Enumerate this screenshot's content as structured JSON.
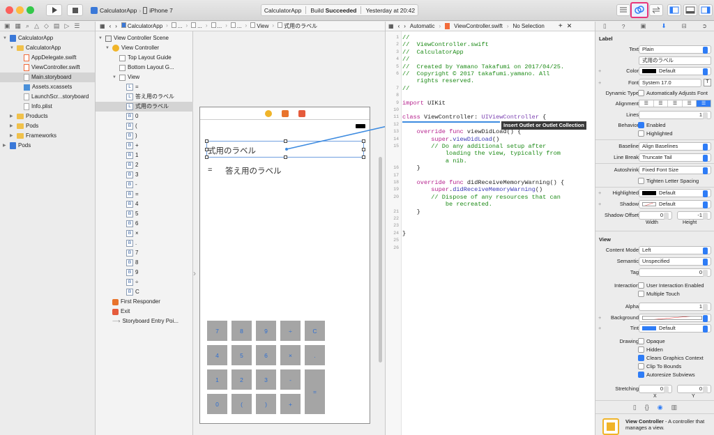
{
  "toolbar": {
    "scheme_app": "CalculatorApp",
    "scheme_device": "iPhone 7",
    "status_app": "CalculatorApp",
    "status_build_prefix": "Build",
    "status_build_result": "Succeeded",
    "status_time": "Yesterday at 20:42"
  },
  "navigator": {
    "items": [
      {
        "label": "CalculatorApp",
        "icon": "project-icon",
        "indent": 0,
        "open": true
      },
      {
        "label": "CalculatorApp",
        "icon": "folder-icon",
        "indent": 1,
        "open": true
      },
      {
        "label": "AppDelegate.swift",
        "icon": "swift-file-icon",
        "indent": 2
      },
      {
        "label": "ViewController.swift",
        "icon": "swift-file-icon",
        "indent": 2
      },
      {
        "label": "Main.storyboard",
        "icon": "storyboard-icon",
        "indent": 2,
        "selected": true
      },
      {
        "label": "Assets.xcassets",
        "icon": "assets-icon",
        "indent": 2
      },
      {
        "label": "LaunchScr...storyboard",
        "icon": "storyboard-icon",
        "indent": 2
      },
      {
        "label": "Info.plist",
        "icon": "plist-icon",
        "indent": 2
      },
      {
        "label": "Products",
        "icon": "folder-icon",
        "indent": 1,
        "closed": true
      },
      {
        "label": "Pods",
        "icon": "folder-icon",
        "indent": 1,
        "closed": true
      },
      {
        "label": "Frameworks",
        "icon": "folder-icon",
        "indent": 1,
        "closed": true
      },
      {
        "label": "Pods",
        "icon": "project-icon",
        "indent": 0,
        "closed": true
      }
    ]
  },
  "jumpbar": {
    "crumbs": [
      "CalculatorApp",
      "...",
      "...",
      "...",
      "...",
      "View",
      "式用のラベル"
    ]
  },
  "outline": {
    "scene": "View Controller Scene",
    "controller": "View Controller",
    "guides": [
      "Top Layout Guide",
      "Bottom Layout G..."
    ],
    "view": "View",
    "children": [
      {
        "t": "L",
        "label": "="
      },
      {
        "t": "L",
        "label": "答え用のラベル"
      },
      {
        "t": "L",
        "label": "式用のラベル",
        "selected": true
      },
      {
        "t": "B",
        "label": "0"
      },
      {
        "t": "B",
        "label": "("
      },
      {
        "t": "B",
        "label": ")"
      },
      {
        "t": "B",
        "label": "+"
      },
      {
        "t": "B",
        "label": "1"
      },
      {
        "t": "B",
        "label": "2"
      },
      {
        "t": "B",
        "label": "3"
      },
      {
        "t": "B",
        "label": "-"
      },
      {
        "t": "B",
        "label": "="
      },
      {
        "t": "B",
        "label": "4"
      },
      {
        "t": "B",
        "label": "5"
      },
      {
        "t": "B",
        "label": "6"
      },
      {
        "t": "B",
        "label": "×"
      },
      {
        "t": "B",
        "label": "."
      },
      {
        "t": "B",
        "label": "7"
      },
      {
        "t": "B",
        "label": "8"
      },
      {
        "t": "B",
        "label": "9"
      },
      {
        "t": "B",
        "label": "÷"
      },
      {
        "t": "B",
        "label": "C"
      }
    ],
    "extras": [
      "First Responder",
      "Exit",
      "Storyboard Entry Poi..."
    ]
  },
  "scene": {
    "formula_label": "式用のラベル",
    "equals": "=",
    "answer_label": "答え用のラベル",
    "keys": [
      [
        "7",
        "8",
        "9",
        "÷",
        "C"
      ],
      [
        "4",
        "5",
        "6",
        "×",
        "."
      ],
      [
        "1",
        "2",
        "3",
        "-"
      ],
      [
        "0",
        "(",
        ")",
        "+"
      ]
    ],
    "equals_key": "="
  },
  "assistant": {
    "mode": "Automatic",
    "file": "ViewController.swift",
    "selection": "No Selection",
    "tooltip": "Insert Outlet or Outlet Collection",
    "lines": [
      {
        "n": "1",
        "c": "//",
        "k": "comment"
      },
      {
        "n": "2",
        "c": "//  ViewController.swift",
        "k": "comment"
      },
      {
        "n": "3",
        "c": "//  CalculatorApp",
        "k": "comment"
      },
      {
        "n": "4",
        "c": "//",
        "k": "comment"
      },
      {
        "n": "5",
        "c": "//  Created by Yamano Takafumi on 2017/04/25.",
        "k": "comment"
      },
      {
        "n": "6",
        "c": "//  Copyright © 2017 takafumi.yamano. All",
        "k": "comment"
      },
      {
        "n": "",
        "c": "    rights reserved.",
        "k": "comment"
      },
      {
        "n": "7",
        "c": "//",
        "k": "comment"
      },
      {
        "n": "8",
        "c": "",
        "k": "plain"
      },
      {
        "n": "9",
        "c": "import UIKit",
        "k": "import"
      },
      {
        "n": "10",
        "c": "",
        "k": "plain"
      },
      {
        "n": "11",
        "c": "class ViewController: UIViewController {",
        "k": "class"
      },
      {
        "n": "12",
        "c": "",
        "k": "plain"
      },
      {
        "n": "13",
        "c": "    override func viewDidLoad() {",
        "k": "func"
      },
      {
        "n": "14",
        "c": "        super.viewDidLoad()",
        "k": "super"
      },
      {
        "n": "15",
        "c": "        // Do any additional setup after",
        "k": "comment"
      },
      {
        "n": "",
        "c": "            loading the view, typically from",
        "k": "comment"
      },
      {
        "n": "",
        "c": "            a nib.",
        "k": "comment"
      },
      {
        "n": "16",
        "c": "    }",
        "k": "plain"
      },
      {
        "n": "17",
        "c": "",
        "k": "plain"
      },
      {
        "n": "18",
        "c": "    override func didReceiveMemoryWarning() {",
        "k": "func"
      },
      {
        "n": "19",
        "c": "        super.didReceiveMemoryWarning()",
        "k": "super"
      },
      {
        "n": "20",
        "c": "        // Dispose of any resources that can",
        "k": "comment"
      },
      {
        "n": "",
        "c": "            be recreated.",
        "k": "comment"
      },
      {
        "n": "21",
        "c": "    }",
        "k": "plain"
      },
      {
        "n": "22",
        "c": "",
        "k": "plain"
      },
      {
        "n": "23",
        "c": "",
        "k": "plain"
      },
      {
        "n": "24",
        "c": "}",
        "k": "plain"
      },
      {
        "n": "25",
        "c": "",
        "k": "plain"
      },
      {
        "n": "26",
        "c": "",
        "k": "plain"
      }
    ]
  },
  "inspector": {
    "label_header": "Label",
    "text_label": "Text",
    "text_value": "Plain",
    "text_content": "式用のラベル",
    "color_label": "Color",
    "color_value": "Default",
    "font_label": "Font",
    "font_value": "System 17.0",
    "dyn_label": "Dynamic Type",
    "dyn_value": "Automatically Adjusts Font",
    "align_label": "Alignment",
    "lines_label": "Lines",
    "lines_value": "1",
    "behavior_label": "Behavior",
    "enabled": "Enabled",
    "highlighted": "Highlighted",
    "baseline_label": "Baseline",
    "baseline_value": "Align Baselines",
    "linebreak_label": "Line Break",
    "linebreak_value": "Truncate Tail",
    "autoshrink_label": "Autoshrink",
    "autoshrink_value": "Fixed Font Size",
    "tighten": "Tighten Letter Spacing",
    "hl_label": "Highlighted",
    "hl_value": "Default",
    "shadow_label": "Shadow",
    "shadow_value": "Default",
    "shoff_label": "Shadow Offset",
    "shoff_w": "0",
    "shoff_h": "-1",
    "width": "Width",
    "height": "Height",
    "view_header": "View",
    "cm_label": "Content Mode",
    "cm_value": "Left",
    "sem_label": "Semantic",
    "sem_value": "Unspecified",
    "tag_label": "Tag",
    "tag_value": "0",
    "inter_label": "Interaction",
    "uie": "User Interaction Enabled",
    "mt": "Multiple Touch",
    "alpha_label": "Alpha",
    "alpha_value": "1",
    "bg_label": "Background",
    "tint_label": "Tint",
    "tint_value": "Default",
    "drawing_label": "Drawing",
    "opaque": "Opaque",
    "hidden": "Hidden",
    "cgc": "Clears Graphics Context",
    "ctb": "Clip To Bounds",
    "asv": "Autoresize Subviews",
    "stretch_label": "Stretching",
    "stretch_x": "0",
    "stretch_y": "0",
    "x": "X",
    "y": "Y",
    "lib_title": "View Controller",
    "lib_desc": " - A controller that manages a view."
  },
  "colors": {
    "accent": "#2e7cf6",
    "connection": "#3d8be0",
    "key_gray": "#a5a5a5",
    "highlight_pink": "#e8357a"
  }
}
